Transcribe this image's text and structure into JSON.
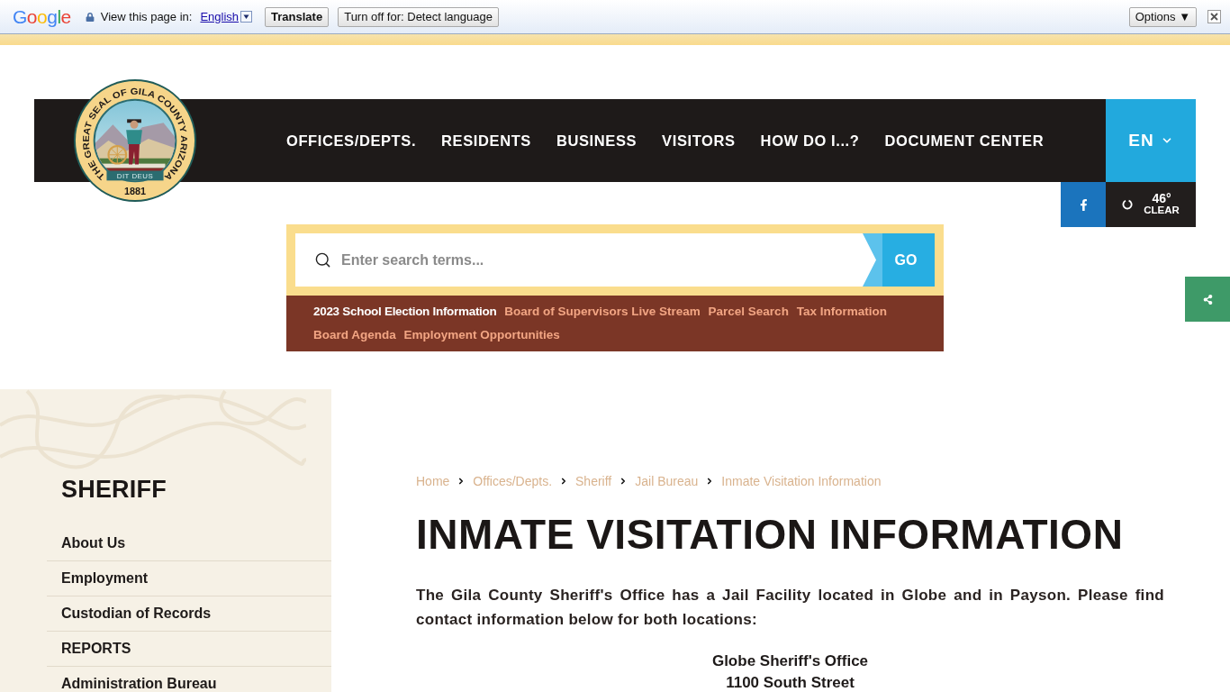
{
  "translate_bar": {
    "logo": "Google",
    "prompt": "View this page in:",
    "language_link": "English",
    "translate_button": "Translate",
    "turn_off_button": "Turn off for: Detect language",
    "options_button": "Options ▼"
  },
  "header": {
    "seal": {
      "ring_text": "THE GREAT SEAL OF GILA COUNTY ARIZONA",
      "motto": "DIT DEUS",
      "year": "1881"
    },
    "nav_items": [
      "OFFICES/DEPTS.",
      "RESIDENTS",
      "BUSINESS",
      "VISITORS",
      "HOW DO I...?",
      "DOCUMENT CENTER"
    ],
    "language": "EN",
    "weather": {
      "temperature": "46°",
      "condition": "CLEAR"
    }
  },
  "search": {
    "placeholder": "Enter search terms...",
    "button": "GO"
  },
  "quick_links": [
    {
      "label": "2023 School Election Information",
      "highlighted": true
    },
    {
      "label": "Board of Supervisors Live Stream",
      "highlighted": false
    },
    {
      "label": "Parcel Search",
      "highlighted": false
    },
    {
      "label": "Tax Information",
      "highlighted": false
    },
    {
      "label": "Board Agenda",
      "highlighted": false
    },
    {
      "label": "Employment Opportunities",
      "highlighted": false
    }
  ],
  "sidebar": {
    "title": "SHERIFF",
    "items": [
      "About Us",
      "Employment",
      "Custodian of Records",
      "REPORTS",
      "Administration Bureau"
    ]
  },
  "breadcrumbs": [
    "Home",
    "Offices/Depts.",
    "Sheriff",
    "Jail Bureau",
    "Inmate Visitation Information"
  ],
  "page_title": "INMATE VISITATION INFORMATION",
  "intro": "The Gila County Sheriff's Office has a Jail Facility located in Globe and in Payson. Please find contact information below for both locations:",
  "address_lines": [
    "Globe Sheriff's Office",
    "1100 South Street"
  ]
}
